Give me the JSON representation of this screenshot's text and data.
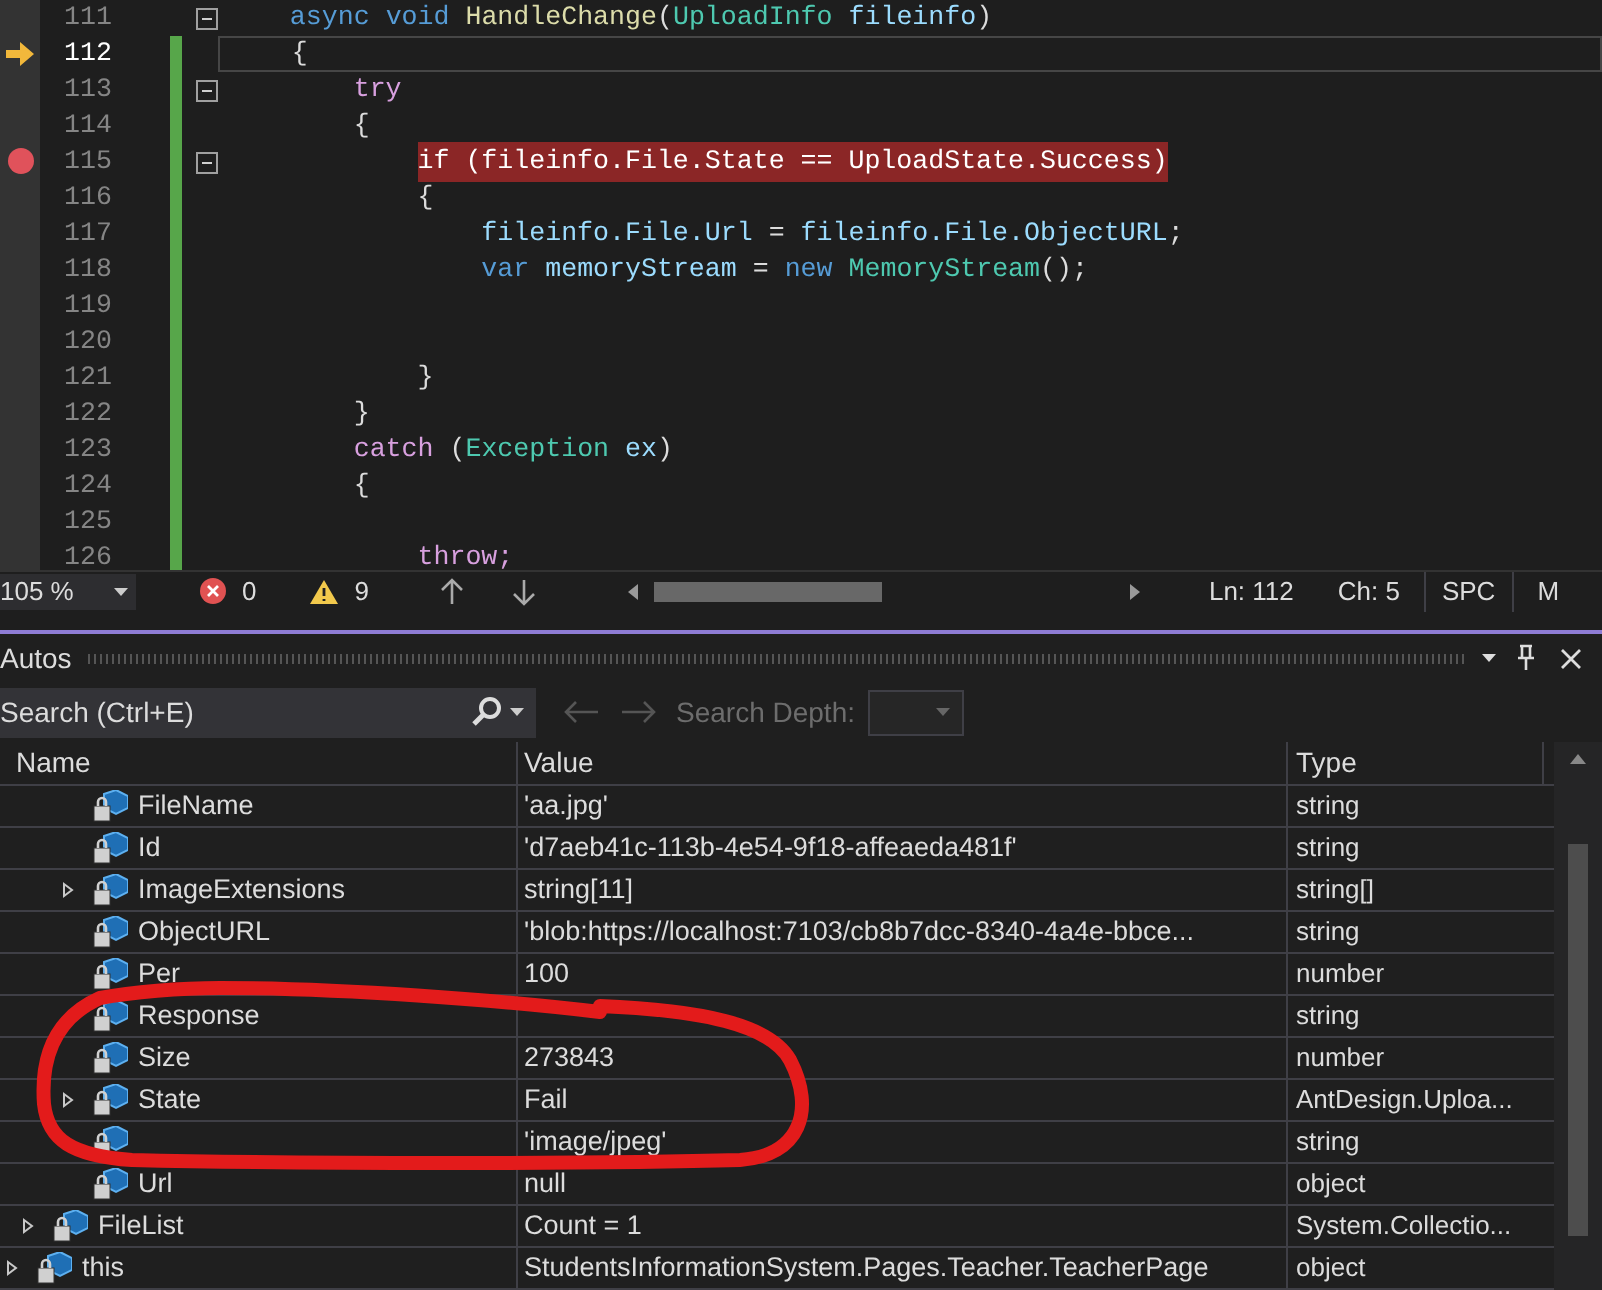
{
  "editor": {
    "lines": [
      {
        "number": "111",
        "current": false,
        "breakpoint": false,
        "foldable": true,
        "changed": false,
        "tokens": [
          {
            "text": "    async",
            "kind": "keyword"
          },
          {
            "text": " void",
            "kind": "keyword"
          },
          {
            "text": " HandleChange",
            "kind": "method"
          },
          {
            "text": "(",
            "kind": "plain"
          },
          {
            "text": "UploadInfo",
            "kind": "type"
          },
          {
            "text": " fileinfo",
            "kind": "variable"
          },
          {
            "text": ")",
            "kind": "plain"
          }
        ]
      },
      {
        "number": "112",
        "current": true,
        "breakpoint": false,
        "foldable": false,
        "changed": true,
        "tokens": [
          {
            "text": "    {",
            "kind": "plain"
          }
        ]
      },
      {
        "number": "113",
        "current": false,
        "breakpoint": false,
        "foldable": true,
        "changed": true,
        "tokens": [
          {
            "text": "        try",
            "kind": "control"
          }
        ]
      },
      {
        "number": "114",
        "current": false,
        "breakpoint": false,
        "foldable": false,
        "changed": true,
        "tokens": [
          {
            "text": "        {",
            "kind": "plain"
          }
        ]
      },
      {
        "number": "115",
        "current": false,
        "breakpoint": true,
        "foldable": true,
        "changed": true,
        "tokens": [
          {
            "text": "            if (fileinfo.File.State == UploadState.Success)",
            "kind": "hit"
          }
        ]
      },
      {
        "number": "116",
        "current": false,
        "breakpoint": false,
        "foldable": false,
        "changed": true,
        "tokens": [
          {
            "text": "            {",
            "kind": "plain"
          }
        ]
      },
      {
        "number": "117",
        "current": false,
        "breakpoint": false,
        "foldable": false,
        "changed": true,
        "tokens": [
          {
            "text": "                fileinfo.File.Url",
            "kind": "variable"
          },
          {
            "text": " = ",
            "kind": "plain"
          },
          {
            "text": "fileinfo.File.ObjectURL",
            "kind": "variable"
          },
          {
            "text": ";",
            "kind": "plain"
          }
        ]
      },
      {
        "number": "118",
        "current": false,
        "breakpoint": false,
        "foldable": false,
        "changed": true,
        "tokens": [
          {
            "text": "                var",
            "kind": "keyword"
          },
          {
            "text": " memoryStream",
            "kind": "variable"
          },
          {
            "text": " = ",
            "kind": "plain"
          },
          {
            "text": "new",
            "kind": "keyword"
          },
          {
            "text": " MemoryStream",
            "kind": "type"
          },
          {
            "text": "();",
            "kind": "plain"
          }
        ]
      },
      {
        "number": "119",
        "current": false,
        "breakpoint": false,
        "foldable": false,
        "changed": true
      },
      {
        "number": "120",
        "current": false,
        "breakpoint": false,
        "foldable": false,
        "changed": true
      },
      {
        "number": "121",
        "current": false,
        "breakpoint": false,
        "foldable": false,
        "changed": true,
        "tokens": [
          {
            "text": "            }",
            "kind": "plain"
          }
        ]
      },
      {
        "number": "122",
        "current": false,
        "breakpoint": false,
        "foldable": false,
        "changed": true,
        "tokens": [
          {
            "text": "        }",
            "kind": "plain"
          }
        ]
      },
      {
        "number": "123",
        "current": false,
        "breakpoint": false,
        "foldable": false,
        "changed": true,
        "tokens": [
          {
            "text": "        catch",
            "kind": "control"
          },
          {
            "text": " (",
            "kind": "plain"
          },
          {
            "text": "Exception",
            "kind": "type"
          },
          {
            "text": " ex",
            "kind": "variable"
          },
          {
            "text": ")",
            "kind": "plain"
          }
        ]
      },
      {
        "number": "124",
        "current": false,
        "breakpoint": false,
        "foldable": false,
        "changed": true,
        "tokens": [
          {
            "text": "        {",
            "kind": "plain"
          }
        ]
      },
      {
        "number": "125",
        "current": false,
        "breakpoint": false,
        "foldable": false,
        "changed": true
      },
      {
        "number": "126",
        "current": false,
        "breakpoint": false,
        "foldable": false,
        "changed": true,
        "tokens": [
          {
            "text": "            throw;",
            "kind": "control"
          }
        ]
      }
    ]
  },
  "status_bar": {
    "zoom": "105 %",
    "errors": "0",
    "warnings": "9",
    "line": "Ln: 112",
    "column": "Ch: 5",
    "whitespace": "SPC",
    "encoding": "M"
  },
  "autos": {
    "title": "Autos",
    "search": {
      "placeholder": "Search (Ctrl+E)"
    },
    "search_depth_label": "Search Depth:",
    "columns": [
      "Name",
      "Value",
      "Type"
    ],
    "rows": [
      {
        "children": [
          {
            "children": [
              {
                "name": "FileName",
                "value": "'aa.jpg'",
                "type": "string",
                "expandable": false
              },
              {
                "name": "Id",
                "value": "'d7aeb41c-113b-4e54-9f18-affeaeda481f'",
                "type": "string",
                "expandable": false
              },
              {
                "name": "ImageExtensions",
                "value": "string[11]",
                "type": "string[]",
                "expandable": true
              },
              {
                "name": "ObjectURL",
                "value": "'blob:https://localhost:7103/cb8b7dcc-8340-4a4e-bbce...",
                "type": "string",
                "expandable": false
              },
              {
                "name": "Per",
                "value": "100",
                "type": "number",
                "expandable": false
              },
              {
                "name": "Response",
                "type": "string",
                "expandable": false
              },
              {
                "name": "Size",
                "value": "273843",
                "type": "number",
                "expandable": false
              },
              {
                "name": "State",
                "value": "Fail",
                "type": "AntDesign.Uploa...",
                "expandable": true
              },
              {
                "value": "'image/jpeg'",
                "type": "string",
                "expandable": false
              },
              {
                "name": "Url",
                "value": "null",
                "type": "object",
                "expandable": false
              }
            ]
          },
          {
            "name": "FileList",
            "value": "Count = 1",
            "type": "System.Collectio...",
            "expandable": true
          }
        ]
      },
      {
        "name": "this",
        "value": "StudentsInformationSystem.Pages.Teacher.TeacherPage",
        "type": "object",
        "expandable": true
      }
    ]
  }
}
